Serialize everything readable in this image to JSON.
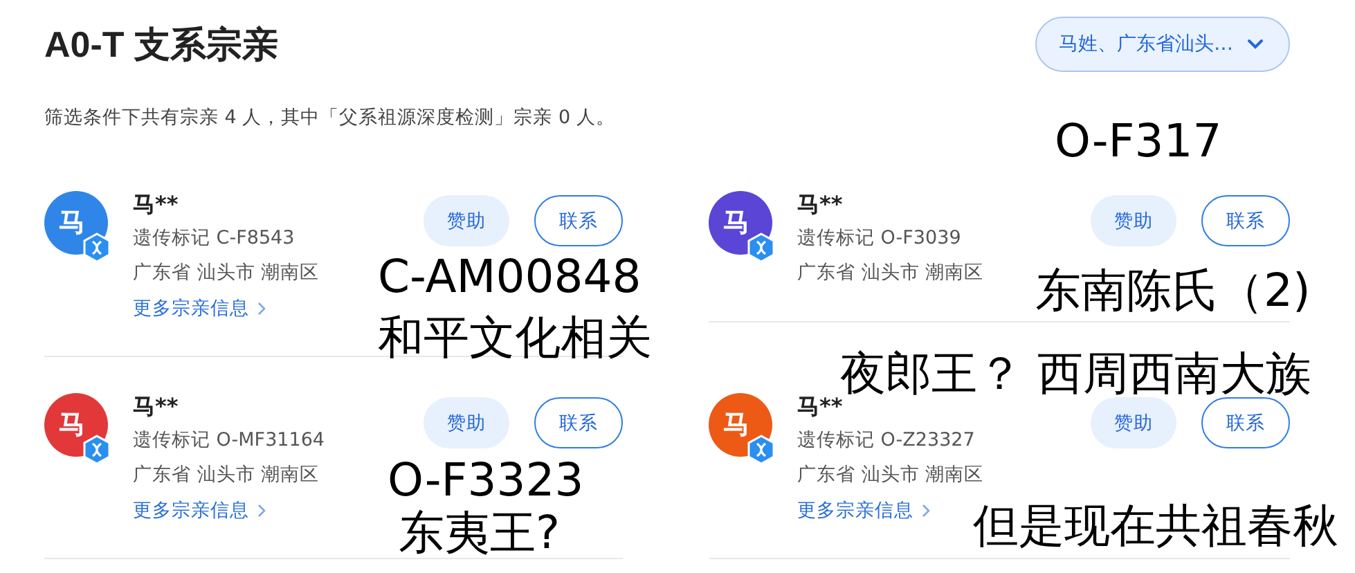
{
  "title": "A0-T 支系宗亲",
  "filter": {
    "value": "马姓、广东省汕头…"
  },
  "summary": "筛选条件下共有宗亲 4 人，其中「父系祖源深度检测」宗亲 0 人。",
  "relatives": [
    {
      "avatar_char": "马",
      "color": "#2f86e8",
      "name": "马**",
      "marker": "遗传标记 C-F8543",
      "location": "广东省 汕头市 潮南区",
      "more_link": "更多宗亲信息",
      "buttons": [
        "赞助",
        "联系"
      ]
    },
    {
      "avatar_char": "马",
      "color": "#5a45d6",
      "name": "马**",
      "marker": "遗传标记 O-F3039",
      "location": "广东省 汕头市 潮南区",
      "buttons": [
        "赞助",
        "联系"
      ]
    },
    {
      "avatar_char": "马",
      "color": "#e2383a",
      "name": "马**",
      "marker": "遗传标记 O-MF31164",
      "location": "广东省 汕头市 潮南区",
      "more_link": "更多宗亲信息",
      "buttons": [
        "赞助",
        "联系"
      ]
    },
    {
      "avatar_char": "马",
      "color": "#ec5a16",
      "name": "马**",
      "marker": "遗传标记 O-Z23327",
      "location": "广东省 汕头市 潮南区",
      "more_link": "更多宗亲信息",
      "buttons": [
        "赞助",
        "联系"
      ]
    }
  ],
  "annotations": [
    {
      "text": "O-F317"
    },
    {
      "text": "C-AM00848"
    },
    {
      "text": "和平文化相关"
    },
    {
      "text": "东南陈氏（2)"
    },
    {
      "text": "夜郎王？ 西周西南大族"
    },
    {
      "text": "O-F3323"
    },
    {
      "text": "东夷王?"
    },
    {
      "text": "但是现在共祖春秋"
    }
  ]
}
